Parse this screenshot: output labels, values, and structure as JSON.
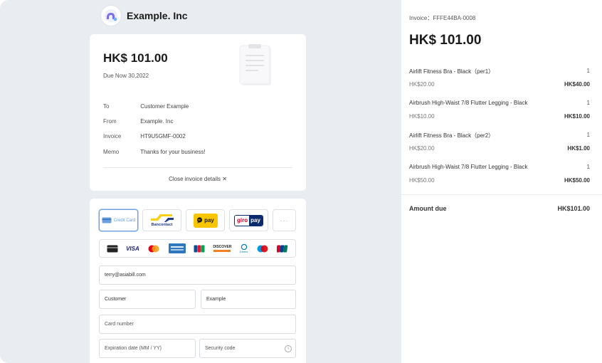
{
  "brand": {
    "name": "Example. Inc"
  },
  "invoice_card": {
    "amount": "HK$ 101.00",
    "due": "Due Now 30,2022",
    "details": [
      {
        "key": "To",
        "value": "Customer Example"
      },
      {
        "key": "From",
        "value": "Example. Inc"
      },
      {
        "key": "Invoice",
        "value": "HT9U5GMF-0002"
      },
      {
        "key": "Memo",
        "value": "Thanks for your business!"
      }
    ],
    "close_label": "Close invoice details ✕"
  },
  "payment": {
    "methods": {
      "credit_card": "Credit Card",
      "bancontact": "Bancontact",
      "gpay": "pay",
      "giropay_a": "giro",
      "giropay_b": "pay",
      "more": "···"
    },
    "brands": {
      "visa": "VISA",
      "discover": "DISCOVER",
      "diners": "Diners"
    },
    "email_value": "terry@asiabill.com",
    "first_name_value": "Customer",
    "last_name_value": "Example",
    "card_number_placeholder": "Card number",
    "expiry_placeholder": "Expiration date (MM / YY)",
    "cvc_placeholder": "Security code",
    "info_glyph": "i"
  },
  "summary": {
    "invoice_label": "Invoice：FFFE44BA-0008",
    "amount": "HK$ 101.00",
    "items": [
      {
        "name": "Airlift Fitness Bra - Black（per1）",
        "qty": "1",
        "unit": "HK$20.00",
        "total": "HK$40.00"
      },
      {
        "name": "Airbrush High-Waist 7/8 Flutter Legging - Black",
        "qty": "1",
        "unit": "HK$10.00",
        "total": "HK$10.00"
      },
      {
        "name": "Airlift Fitness Bra - Black（per2）",
        "qty": "1",
        "unit": "HK$20.00",
        "total": "HK$1.00"
      },
      {
        "name": "Airbrush High-Waist 7/8 Flutter Legging - Black",
        "qty": "1",
        "unit": "HK$50.00",
        "total": "HK$50.00"
      }
    ],
    "amount_due_label": "Amount due",
    "amount_due_value": "HK$101.00"
  },
  "colors": {
    "accent": "#6b9fde",
    "background": "#e9ecf0",
    "panel": "#ffffff"
  }
}
